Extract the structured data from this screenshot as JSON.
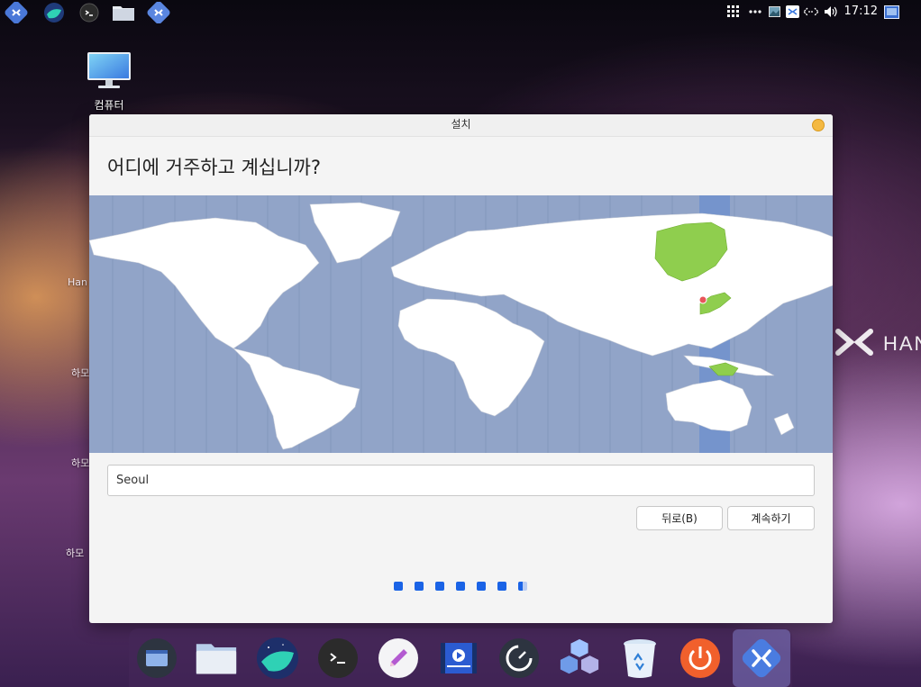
{
  "topbar": {
    "apps": [
      {
        "icon": "hamonikr-launcher-icon"
      },
      {
        "icon": "naver-whale-icon"
      },
      {
        "icon": "terminal-icon"
      },
      {
        "icon": "folder-icon"
      },
      {
        "icon": "hamonikr-app-icon"
      }
    ],
    "tray": [
      "app-grid-icon",
      "more-icon",
      "image-icon",
      "hamonikr-tray-icon",
      "network-icon",
      "volume-icon",
      "notification-icon"
    ],
    "clock": "17:12"
  },
  "desktop": {
    "computer_label": "컴퓨터",
    "side_labels": [
      "Han",
      "하모",
      "하모",
      "하모"
    ],
    "watermark": "HAN"
  },
  "installer": {
    "title": "설치",
    "heading": "어디에 거주하고 계십니까?",
    "location_value": "Seoul",
    "back_label": "뒤로(B)",
    "continue_label": "계속하기",
    "steps_total": 7,
    "steps_done": 6
  },
  "dock": [
    {
      "name": "desktop-switcher",
      "icon": "desktop-icon"
    },
    {
      "name": "file-manager",
      "icon": "folder-icon"
    },
    {
      "name": "naver-whale",
      "icon": "whale-icon"
    },
    {
      "name": "terminal",
      "icon": "terminal-icon"
    },
    {
      "name": "text-editor",
      "icon": "pencil-icon"
    },
    {
      "name": "video-editor",
      "icon": "video-icon"
    },
    {
      "name": "system-monitor",
      "icon": "gauge-icon"
    },
    {
      "name": "package-store",
      "icon": "cubes-icon"
    },
    {
      "name": "trash",
      "icon": "trash-icon"
    },
    {
      "name": "power",
      "icon": "power-icon"
    },
    {
      "name": "hamonikr-menu",
      "icon": "hamonikr-icon"
    }
  ],
  "colors": {
    "accent": "#1a63e6",
    "map_ocean": "#91a4c8",
    "map_selected_zone": "#7594cc",
    "map_highlight_land": "#8fce4e",
    "map_marker": "#e8555a"
  }
}
